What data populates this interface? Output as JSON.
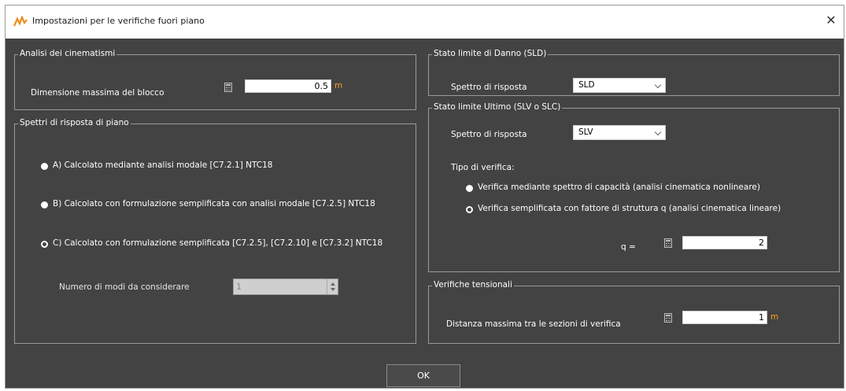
{
  "window": {
    "title": "Impostazioni per le verifiche fuori piano",
    "close_label": "✕"
  },
  "analisi": {
    "legend": "Analisi dei cinematismi",
    "dim_label": "Dimensione massima del blocco",
    "dim_value": "0.5",
    "dim_unit": "m"
  },
  "spettri": {
    "legend": "Spettri di risposta di piano",
    "options": [
      {
        "label": "A) Calcolato mediante analisi modale [C7.2.1] NTC18",
        "selected": false
      },
      {
        "label": "B) Calcolato con formulazione semplificata con analisi modale [C7.2.5] NTC18",
        "selected": false
      },
      {
        "label": "C) Calcolato con formulazione semplificata [C7.2.5], [C7.2.10] e [C7.3.2] NTC18",
        "selected": true
      }
    ],
    "modi_label": "Numero di modi da considerare",
    "modi_value": "1"
  },
  "sld": {
    "legend": "Stato limite di Danno (SLD)",
    "spettro_label": "Spettro di risposta",
    "spettro_value": "SLD"
  },
  "slu": {
    "legend": "Stato limite Ultimo (SLV o SLC)",
    "spettro_label": "Spettro di risposta",
    "spettro_value": "SLV",
    "tipo_label": "Tipo di verifica:",
    "options": [
      {
        "label": "Verifica mediante spettro di capacità (analisi cinematica nonlineare)",
        "selected": false
      },
      {
        "label": "Verifica semplificata con fattore di struttura q (analisi cinematica lineare)",
        "selected": true
      }
    ],
    "q_label": "q =",
    "q_value": "2"
  },
  "tensionali": {
    "legend": "Verifiche tensionali",
    "dist_label": "Distanza massima tra le sezioni di verifica",
    "dist_value": "1",
    "dist_unit": "m"
  },
  "ok_label": "OK",
  "colors": {
    "background": "#434343",
    "accent": "#f7a01a",
    "border": "#9a9a9a"
  },
  "icons": [
    "app-logo-icon",
    "close-icon",
    "calculator-icon",
    "chevron-down-icon",
    "spin-up-icon",
    "spin-down-icon"
  ]
}
